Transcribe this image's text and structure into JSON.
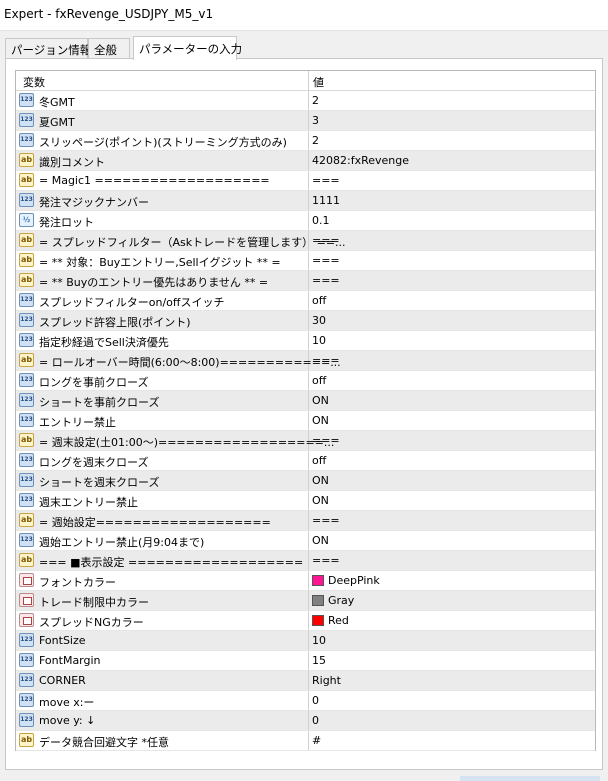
{
  "window": {
    "title": "Expert - fxRevenge_USDJPY_M5_v1"
  },
  "tabs": [
    "パージョン情報",
    "全般",
    "パラメーターの入力"
  ],
  "table": {
    "header": {
      "name": "変数",
      "value": "値"
    },
    "rows": [
      {
        "type": "int",
        "name": "冬GMT",
        "value": "2"
      },
      {
        "type": "int",
        "name": "夏GMT",
        "value": "3"
      },
      {
        "type": "int",
        "name": "スリッページ(ポイント)(ストリーミング方式のみ)",
        "value": "2"
      },
      {
        "type": "string",
        "name": "識別コメント",
        "value": "42082:fxRevenge"
      },
      {
        "type": "string",
        "name": "= Magic1 ===================",
        "value": "==="
      },
      {
        "type": "int",
        "name": "発注マジックナンバー",
        "value": "1111"
      },
      {
        "type": "double",
        "name": "発注ロット",
        "value": "0.1"
      },
      {
        "type": "string",
        "name": "= スプレッドフィルター（Askトレードを管理します） ==...",
        "value": "==="
      },
      {
        "type": "string",
        "name": "= ** 対象：Buyエントリー,Sellイグジット ** =",
        "value": "==="
      },
      {
        "type": "string",
        "name": "= ** Buyのエントリー優先はありません ** =",
        "value": "==="
      },
      {
        "type": "int",
        "name": "スプレッドフィルターon/offスイッチ",
        "value": "off"
      },
      {
        "type": "int",
        "name": "スプレッド許容上限(ポイント)",
        "value": "30"
      },
      {
        "type": "int",
        "name": "指定秒経過でSell決済優先",
        "value": "10"
      },
      {
        "type": "string",
        "name": "= ロールオーバー時間(6:00〜8:00)============...",
        "value": "==="
      },
      {
        "type": "int",
        "name": "ロングを事前クローズ",
        "value": "off"
      },
      {
        "type": "int",
        "name": "ショートを事前クローズ",
        "value": "ON"
      },
      {
        "type": "int",
        "name": "エントリー禁止",
        "value": "ON"
      },
      {
        "type": "string",
        "name": "= 週末設定(土01:00〜)==================...",
        "value": "==="
      },
      {
        "type": "int",
        "name": "ロングを週末クローズ",
        "value": "off"
      },
      {
        "type": "int",
        "name": "ショートを週末クローズ",
        "value": "ON"
      },
      {
        "type": "int",
        "name": "週末エントリー禁止",
        "value": "ON"
      },
      {
        "type": "string",
        "name": "= 週始設定===================",
        "value": "==="
      },
      {
        "type": "int",
        "name": "週始エントリー禁止(月9:04まで)",
        "value": "ON"
      },
      {
        "type": "string",
        "name": "=== ■表示設定 ===================",
        "value": "==="
      },
      {
        "type": "color",
        "name": "フォントカラー",
        "value": "DeepPink",
        "swatch": "#ff1493"
      },
      {
        "type": "color",
        "name": "トレード制限中カラー",
        "value": "Gray",
        "swatch": "#808080"
      },
      {
        "type": "color",
        "name": "スプレッドNGカラー",
        "value": "Red",
        "swatch": "#ff0000"
      },
      {
        "type": "int",
        "name": "FontSize",
        "value": "10"
      },
      {
        "type": "int",
        "name": "FontMargin",
        "value": "15"
      },
      {
        "type": "int",
        "name": "CORNER",
        "value": "Right"
      },
      {
        "type": "int",
        "name": "move x:ー",
        "value": "0"
      },
      {
        "type": "int",
        "name": "move y: ↓",
        "value": "0"
      },
      {
        "type": "string",
        "name": "データ競合回避文字 *任意",
        "value": "#"
      }
    ]
  },
  "icon_labels": {
    "int": "123",
    "string": "ab",
    "double": "½",
    "color": ""
  }
}
